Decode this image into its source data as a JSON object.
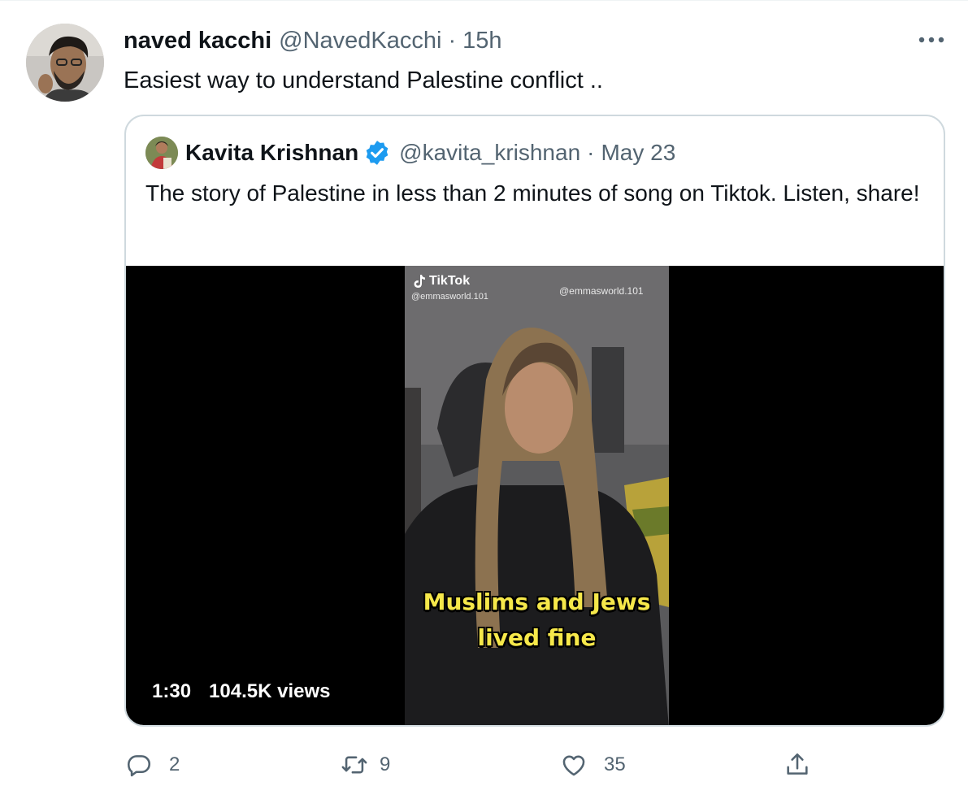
{
  "tweet": {
    "author": {
      "display_name": "naved kacchi",
      "handle": "@NavedKacchi",
      "separator": "·",
      "time": "15h"
    },
    "text": "Easiest way to understand Palestine conflict ..",
    "more_icon": "more-horizontal-icon"
  },
  "quoted_tweet": {
    "author": {
      "display_name": "Kavita Krishnan",
      "verified": true,
      "handle": "@kavita_krishnan",
      "separator": "·",
      "time": "May 23"
    },
    "text": "The story of Palestine in less than 2 minutes of song on Tiktok. Listen, share!",
    "video": {
      "tiktok_logo_text": "TikTok",
      "tiktok_user_top_left": "@emmasworld.101",
      "tiktok_user_top_right": "@emmasworld.101",
      "caption_line_1": "Muslims and Jews",
      "caption_line_2": "lived fine",
      "duration": "1:30",
      "views": "104.5K views"
    }
  },
  "actions": {
    "reply_count": "2",
    "retweet_count": "9",
    "like_count": "35"
  },
  "colors": {
    "text_primary": "#0f1419",
    "text_secondary": "#536471",
    "border": "#cfd9de",
    "verified_blue": "#1d9bf0",
    "caption_yellow": "#f6e84a"
  }
}
